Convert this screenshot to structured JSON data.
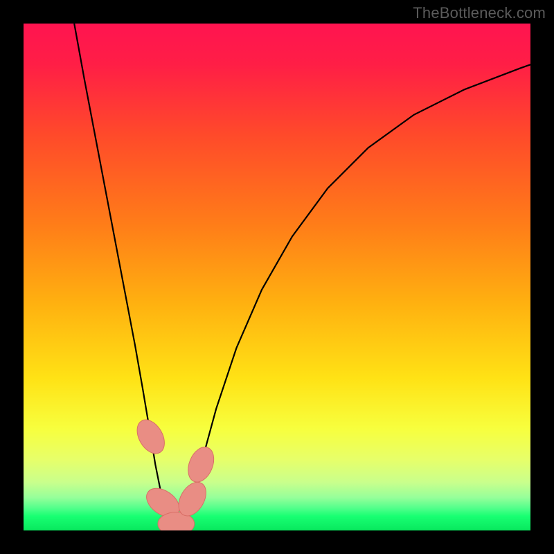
{
  "watermark": "TheBottleneck.com",
  "chart_data": {
    "type": "line",
    "title": "",
    "xlabel": "",
    "ylabel": "",
    "xlim": [
      0,
      100
    ],
    "ylim": [
      0,
      100
    ],
    "series": [
      {
        "name": "curve",
        "x": [
          10,
          12,
          14,
          16,
          18,
          20,
          22,
          23.5,
          25.1,
          26,
          27.5,
          28.4,
          29.2,
          30.1,
          31.1,
          32.2,
          33.3,
          35,
          38,
          42,
          47,
          53,
          60,
          68,
          77,
          87,
          98,
          100
        ],
        "y": [
          100,
          89,
          78.5,
          68,
          57.5,
          47,
          36.5,
          28,
          18.5,
          13,
          5.5,
          2.7,
          1.5,
          1.3,
          1.7,
          3.2,
          6.2,
          13,
          24,
          36,
          47.5,
          58,
          67.5,
          75.5,
          82,
          87,
          91.2,
          91.9
        ]
      }
    ],
    "markers": [
      {
        "cx": 25.1,
        "cy": 18.5,
        "rx": 2.3,
        "ry": 3.6,
        "angle": -30
      },
      {
        "cx": 27.5,
        "cy": 5.5,
        "rx": 2.3,
        "ry": 3.6,
        "angle": -55
      },
      {
        "cx": 30.1,
        "cy": 1.3,
        "rx": 3.6,
        "ry": 2.3,
        "angle": 0
      },
      {
        "cx": 33.3,
        "cy": 6.2,
        "rx": 2.3,
        "ry": 3.6,
        "angle": 30
      },
      {
        "cx": 35.0,
        "cy": 13.0,
        "rx": 2.3,
        "ry": 3.6,
        "angle": 22
      }
    ],
    "gradient_stops": [
      {
        "offset": 0,
        "color": "#ff1450"
      },
      {
        "offset": 0.08,
        "color": "#ff1e46"
      },
      {
        "offset": 0.22,
        "color": "#ff4a2a"
      },
      {
        "offset": 0.4,
        "color": "#ff7e18"
      },
      {
        "offset": 0.55,
        "color": "#ffb010"
      },
      {
        "offset": 0.7,
        "color": "#ffe215"
      },
      {
        "offset": 0.8,
        "color": "#f7ff3e"
      },
      {
        "offset": 0.86,
        "color": "#e7ff6a"
      },
      {
        "offset": 0.905,
        "color": "#c9ff8c"
      },
      {
        "offset": 0.935,
        "color": "#96ff9a"
      },
      {
        "offset": 0.955,
        "color": "#55ff8c"
      },
      {
        "offset": 0.972,
        "color": "#18ff72"
      },
      {
        "offset": 1.0,
        "color": "#08e85e"
      }
    ],
    "colors": {
      "curve": "#000000",
      "marker_fill": "#e98d84",
      "marker_stroke": "#d96e66",
      "background_frame": "#000000"
    }
  }
}
